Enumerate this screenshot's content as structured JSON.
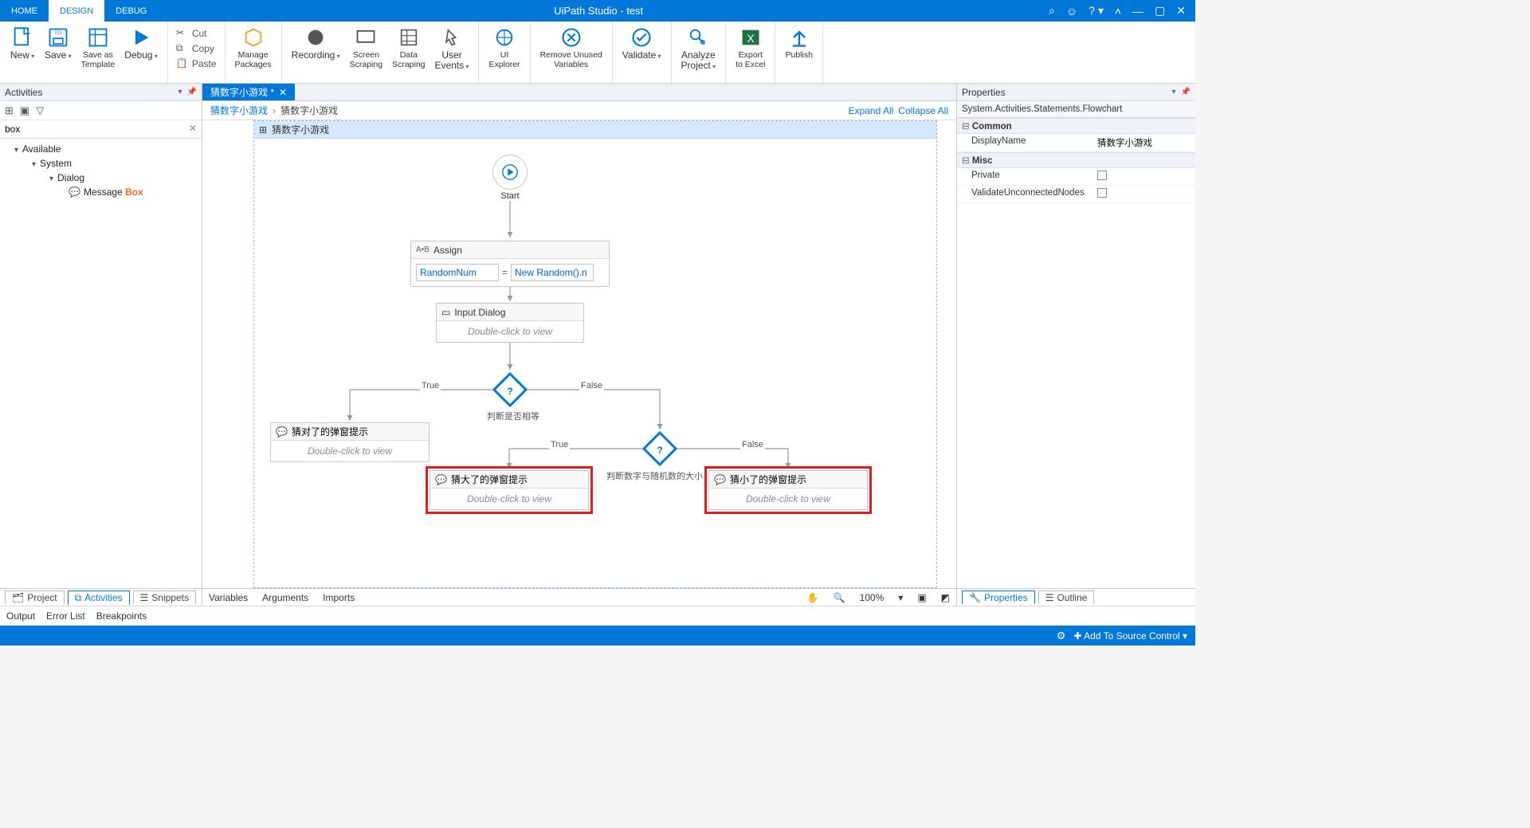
{
  "app": {
    "title": "UiPath Studio - test"
  },
  "menu": {
    "home": "HOME",
    "design": "DESIGN",
    "debug": "DEBUG"
  },
  "ribbon": {
    "new": "New",
    "save": "Save",
    "saveas": "Save as\nTemplate",
    "debug": "Debug",
    "cut": "Cut",
    "copy": "Copy",
    "paste": "Paste",
    "pkg": "Manage\nPackages",
    "rec": "Recording",
    "scr": "Screen\nScraping",
    "data": "Data\nScraping",
    "uevt": "User\nEvents",
    "uiex": "UI\nExplorer",
    "unused": "Remove Unused\nVariables",
    "validate": "Validate",
    "analyze": "Analyze\nProject",
    "export": "Export\nto Excel",
    "publish": "Publish"
  },
  "activities": {
    "title": "Activities",
    "search": "box",
    "tree": {
      "available": "Available",
      "system": "System",
      "dialog": "Dialog",
      "msgboxPrefix": "Message ",
      "msgboxMatch": "Box"
    }
  },
  "bottomTabs": {
    "project": "Project",
    "activities": "Activities",
    "snippets": "Snippets"
  },
  "doc": {
    "tab": "猜数字小游戏 *",
    "bc1": "猜数字小游戏",
    "bc2": "猜数字小游戏",
    "expand": "Expand All",
    "collapse": "Collapse All",
    "flowchartTitle": "猜数字小游戏",
    "start": "Start",
    "assign": {
      "title": "Assign",
      "lhs": "RandomNum",
      "rhs": "New Random().n"
    },
    "inputDialog": {
      "title": "Input Dialog",
      "hint": "Double-click to view"
    },
    "dec1": {
      "label": "判断是否相等",
      "t": "True",
      "f": "False"
    },
    "dec2": {
      "label": "判断数字与随机数的大小",
      "t": "True",
      "f": "False"
    },
    "msgCorrect": {
      "title": "猜对了的弹窗提示",
      "hint": "Double-click to view"
    },
    "msgBig": {
      "title": "猜大了的弹窗提示",
      "hint": "Double-click to view"
    },
    "msgSmall": {
      "title": "猜小了的弹窗提示",
      "hint": "Double-click to view"
    },
    "vars": "Variables",
    "args": "Arguments",
    "imports": "Imports",
    "zoom": "100%"
  },
  "props": {
    "title": "Properties",
    "type": "System.Activities.Statements.Flowchart",
    "catCommon": "Common",
    "displayNameK": "DisplayName",
    "displayNameV": "猜数字小游戏",
    "catMisc": "Misc",
    "privateK": "Private",
    "validateK": "ValidateUnconnectedNodes",
    "btabProps": "Properties",
    "btabOutline": "Outline"
  },
  "outrow": {
    "output": "Output",
    "errorlist": "Error List",
    "breakpoints": "Breakpoints"
  },
  "status": {
    "scm": "Add To Source Control"
  }
}
